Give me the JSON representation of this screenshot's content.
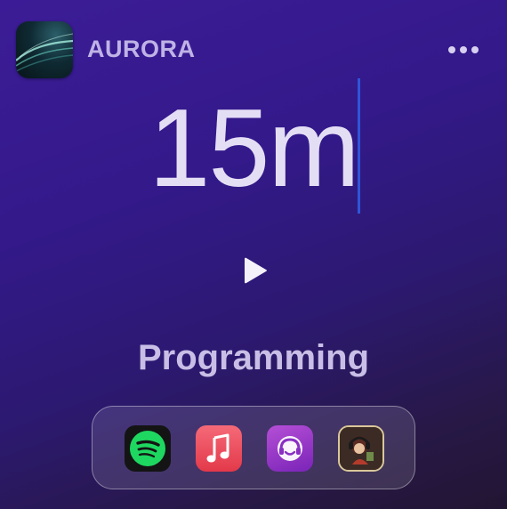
{
  "header": {
    "app_name": "AURORA",
    "app_icon": "aurora-icon",
    "more_icon": "more-horizontal-icon"
  },
  "timer": {
    "value": "15m"
  },
  "player": {
    "play_icon": "play-icon"
  },
  "category": {
    "label": "Programming"
  },
  "dock": {
    "apps": [
      {
        "name": "spotify",
        "icon": "spotify-icon"
      },
      {
        "name": "music",
        "icon": "music-note-icon"
      },
      {
        "name": "podcast",
        "icon": "headphones-icon"
      },
      {
        "name": "game",
        "icon": "character-icon"
      }
    ]
  },
  "colors": {
    "background_top": "#3c1c96",
    "background_bottom": "#221532",
    "caret": "#2f55d8",
    "spotify_green": "#1ed760"
  }
}
